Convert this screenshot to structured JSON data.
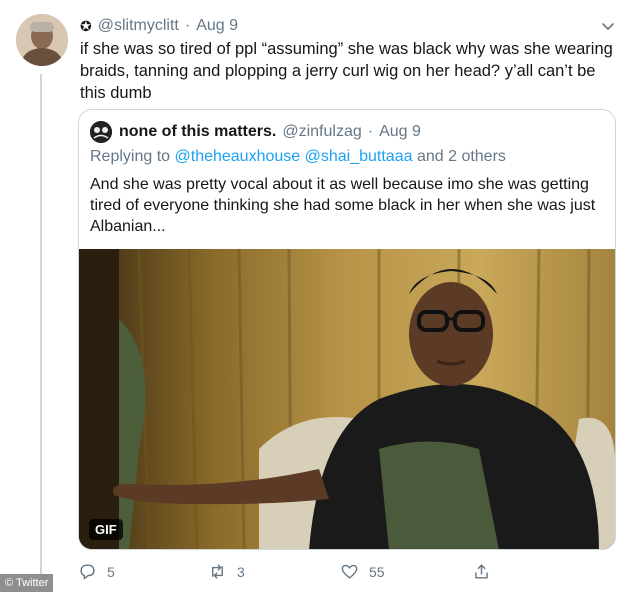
{
  "tweet": {
    "display_name": "@slitmyclitt",
    "date": "Aug 9",
    "text": "if she was so tired of ppl “assuming” she was black why was she wearing braids, tanning and plopping a jerry curl wig on her head? y’all can’t be this dumb"
  },
  "quote": {
    "name": "none of this matters.",
    "handle": "@zinfulzag",
    "date": "Aug 9",
    "replying_prefix": "Replying to",
    "replying_mentions": "@theheauxhouse @shai_buttaaa",
    "replying_suffix": "and 2 others",
    "text": "And she was pretty vocal about it as well because imo she was getting tired of everyone thinking she had some black in her when she was just Albanian...",
    "media_badge": "GIF"
  },
  "actions": {
    "replies": "5",
    "retweets": "3",
    "likes": "55"
  },
  "watermark": "© Twitter"
}
